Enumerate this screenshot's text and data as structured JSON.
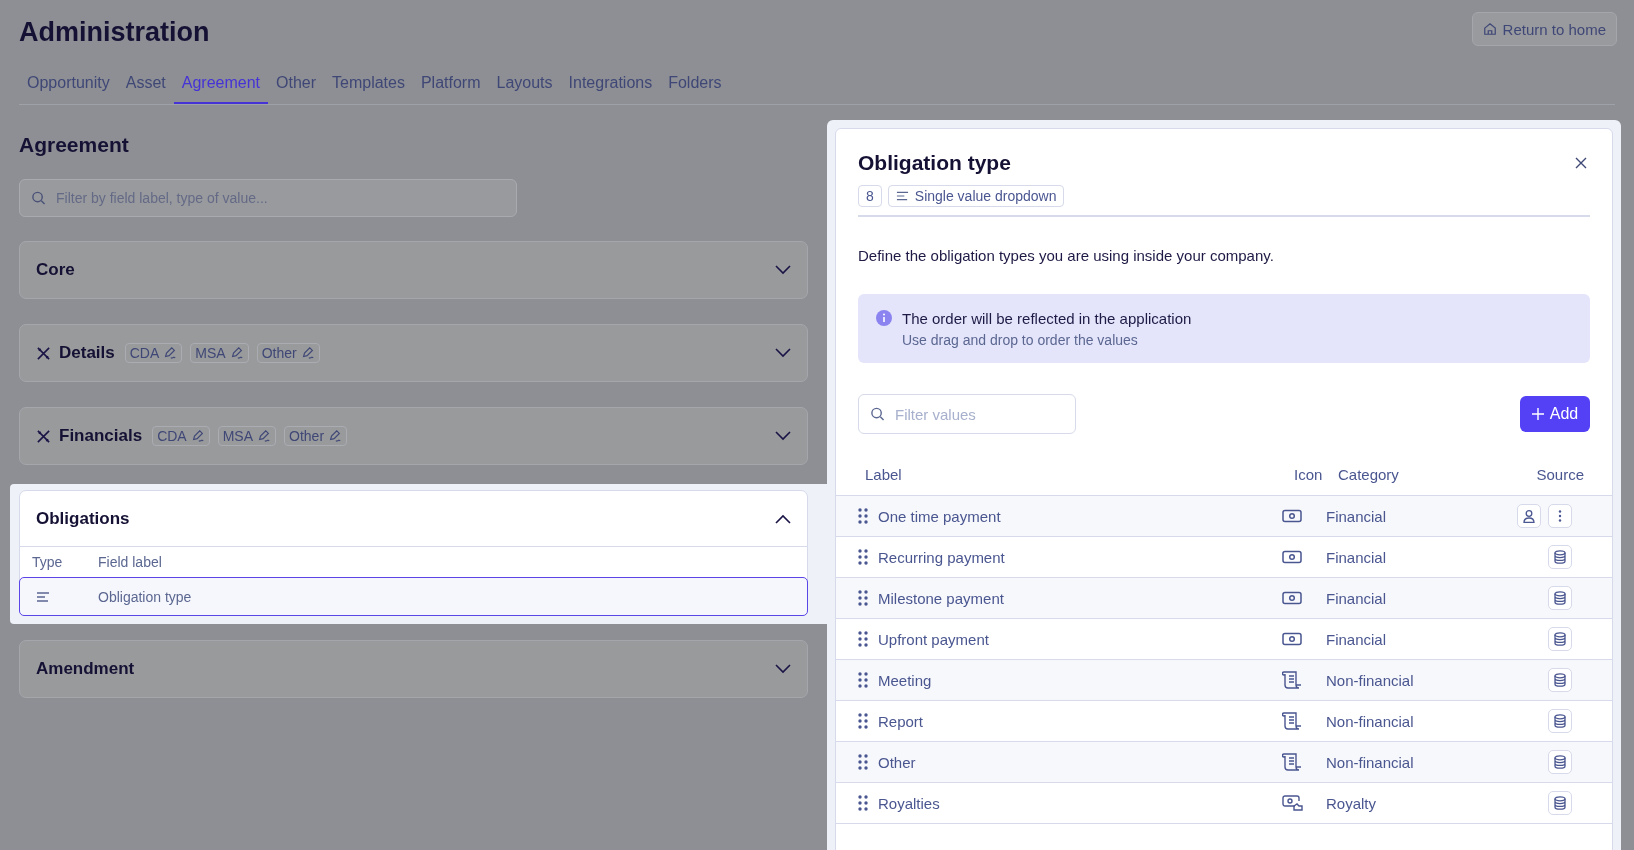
{
  "header": {
    "title": "Administration",
    "return_button": "Return to home"
  },
  "tabs": [
    {
      "label": "Opportunity",
      "selected": false
    },
    {
      "label": "Asset",
      "selected": false
    },
    {
      "label": "Agreement",
      "selected": true
    },
    {
      "label": "Other",
      "selected": false
    },
    {
      "label": "Templates",
      "selected": false
    },
    {
      "label": "Platform",
      "selected": false
    },
    {
      "label": "Layouts",
      "selected": false
    },
    {
      "label": "Integrations",
      "selected": false
    },
    {
      "label": "Folders",
      "selected": false
    }
  ],
  "page": {
    "title": "Agreement",
    "search": {
      "placeholder": "Filter by field label, type of value..."
    }
  },
  "sections": [
    {
      "title": "Core",
      "expanded": false
    },
    {
      "title": "Details",
      "expanded": false,
      "tags": [
        {
          "label": "CDA"
        },
        {
          "label": "MSA"
        },
        {
          "label": "Other"
        }
      ]
    },
    {
      "title": "Financials",
      "expanded": false,
      "tags": [
        {
          "label": "CDA"
        },
        {
          "label": "MSA"
        },
        {
          "label": "Other"
        }
      ]
    },
    {
      "title": "Obligations",
      "expanded": true,
      "columns": [
        "Type",
        "Field label"
      ],
      "fields": [
        {
          "label": "Obligation type",
          "selected": true
        }
      ]
    },
    {
      "title": "Amendment",
      "expanded": false
    }
  ],
  "panel": {
    "title": "Obligation type",
    "count": "8",
    "type_chip": "Single value dropdown",
    "description": "Define the obligation types you are using inside your company.",
    "info": {
      "title": "The order will be reflected in the application",
      "text": "Use drag and drop to order the values"
    },
    "filter": {
      "placeholder": "Filter values"
    },
    "add_button": "Add",
    "columns": [
      "Label",
      "Icon",
      "Category",
      "Source"
    ],
    "rows": [
      {
        "label": "One time payment",
        "kind": "payment",
        "category": "Financial",
        "user_added": true,
        "menu": true
      },
      {
        "label": "Recurring payment",
        "kind": "payment",
        "category": "Financial",
        "user_added": false,
        "menu": false
      },
      {
        "label": "Milestone payment",
        "kind": "payment",
        "category": "Financial",
        "user_added": false,
        "menu": false
      },
      {
        "label": "Upfront payment",
        "kind": "payment",
        "category": "Financial",
        "user_added": false,
        "menu": false
      },
      {
        "label": "Meeting",
        "kind": "document",
        "category": "Non-financial",
        "user_added": false,
        "menu": false
      },
      {
        "label": "Report",
        "kind": "document",
        "category": "Non-financial",
        "user_added": false,
        "menu": false
      },
      {
        "label": "Other",
        "kind": "document",
        "category": "Non-financial",
        "user_added": false,
        "menu": false
      },
      {
        "label": "Royalties",
        "kind": "royalty",
        "category": "Royalty",
        "user_added": false,
        "menu": false
      }
    ]
  }
}
